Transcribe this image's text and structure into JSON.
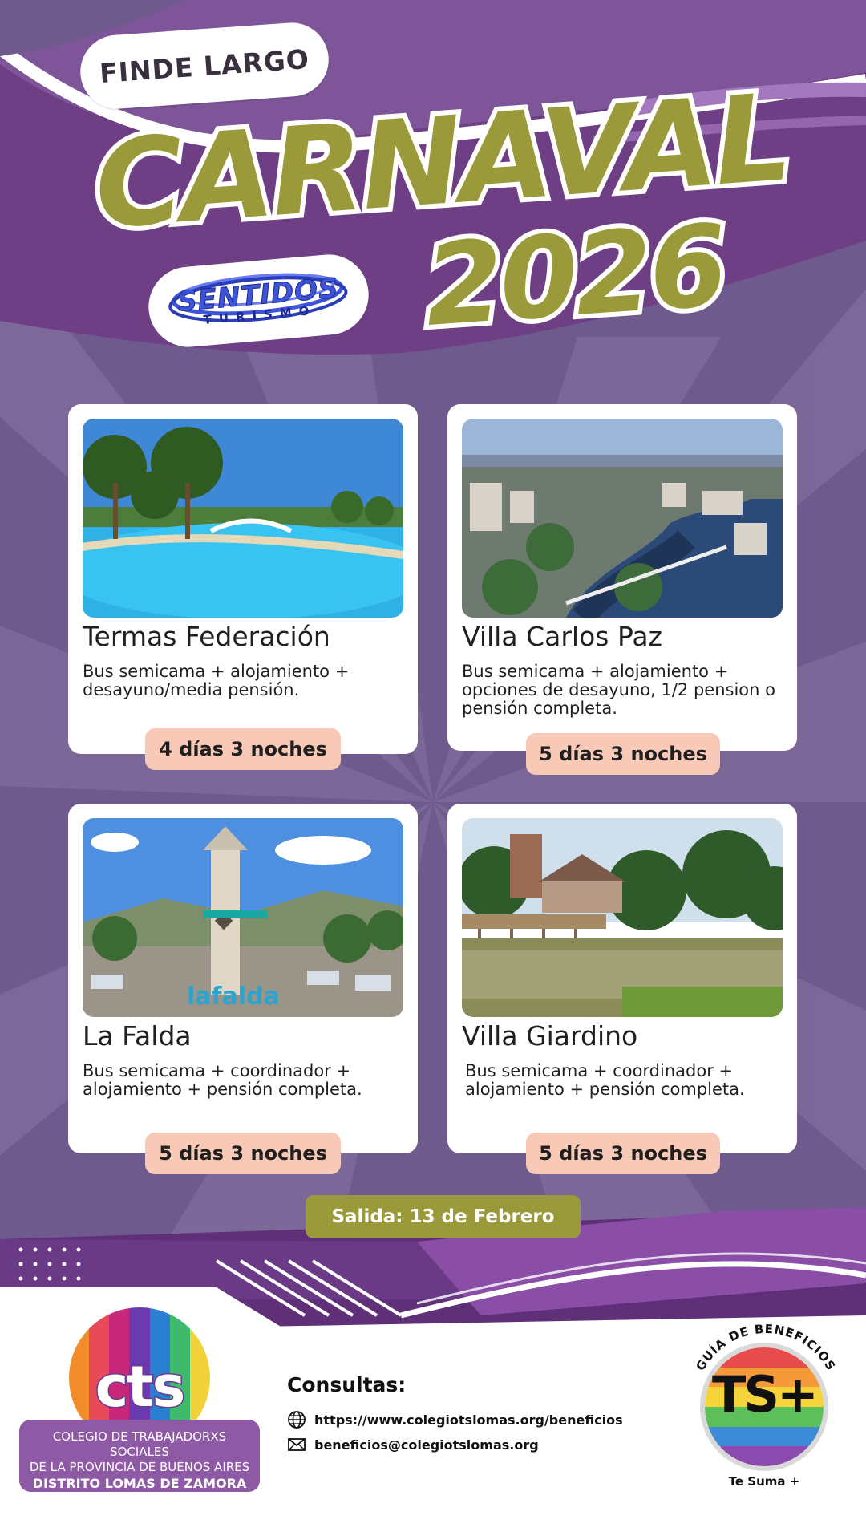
{
  "header": {
    "pill_label": "FINDE LARGO",
    "title": "CARNAVAL",
    "year": "2026",
    "operator_logo": {
      "name": "SENTIDOS",
      "sub": "TURISMO"
    }
  },
  "destinations": [
    {
      "name": "Termas Federación",
      "description": "Bus semicama + alojamiento + desayuno/media pensión.",
      "duration": "4 días 3 noches"
    },
    {
      "name": "Villa Carlos Paz",
      "description": "Bus semicama + alojamiento + opciones de desayuno, 1/2 pension o pensión completa.",
      "duration": "5 días 3 noches"
    },
    {
      "name": "La Falda",
      "description": "Bus semicama + coordinador + alojamiento + pensión completa.",
      "duration": "5 días 3 noches"
    },
    {
      "name": "Villa Giardino",
      "description": "Bus semicama + coordinador + alojamiento + pensión completa.",
      "duration": "5 días 3 noches"
    }
  ],
  "departure": "Salida: 13 de Febrero",
  "footer": {
    "org_logo": {
      "mark": "cts",
      "line1": "COLEGIO DE TRABAJADORXS SOCIALES",
      "line2": "DE LA PROVINCIA DE BUENOS AIRES",
      "line3": "DISTRITO LOMAS DE ZAMORA"
    },
    "consultas_label": "Consultas:",
    "website": "https://www.colegiotslomas.org/beneficios",
    "email": "beneficios@colegiotslomas.org",
    "badge": {
      "arc_text": "GUÍA DE BENEFICIOS",
      "mark": "TS+",
      "tagline": "Te Suma +"
    }
  },
  "colors": {
    "background": "#6e5a8c",
    "accent_olive": "#9b9a3a",
    "badge_peach": "#f8c9b7",
    "purple": "#7a4a9a"
  }
}
